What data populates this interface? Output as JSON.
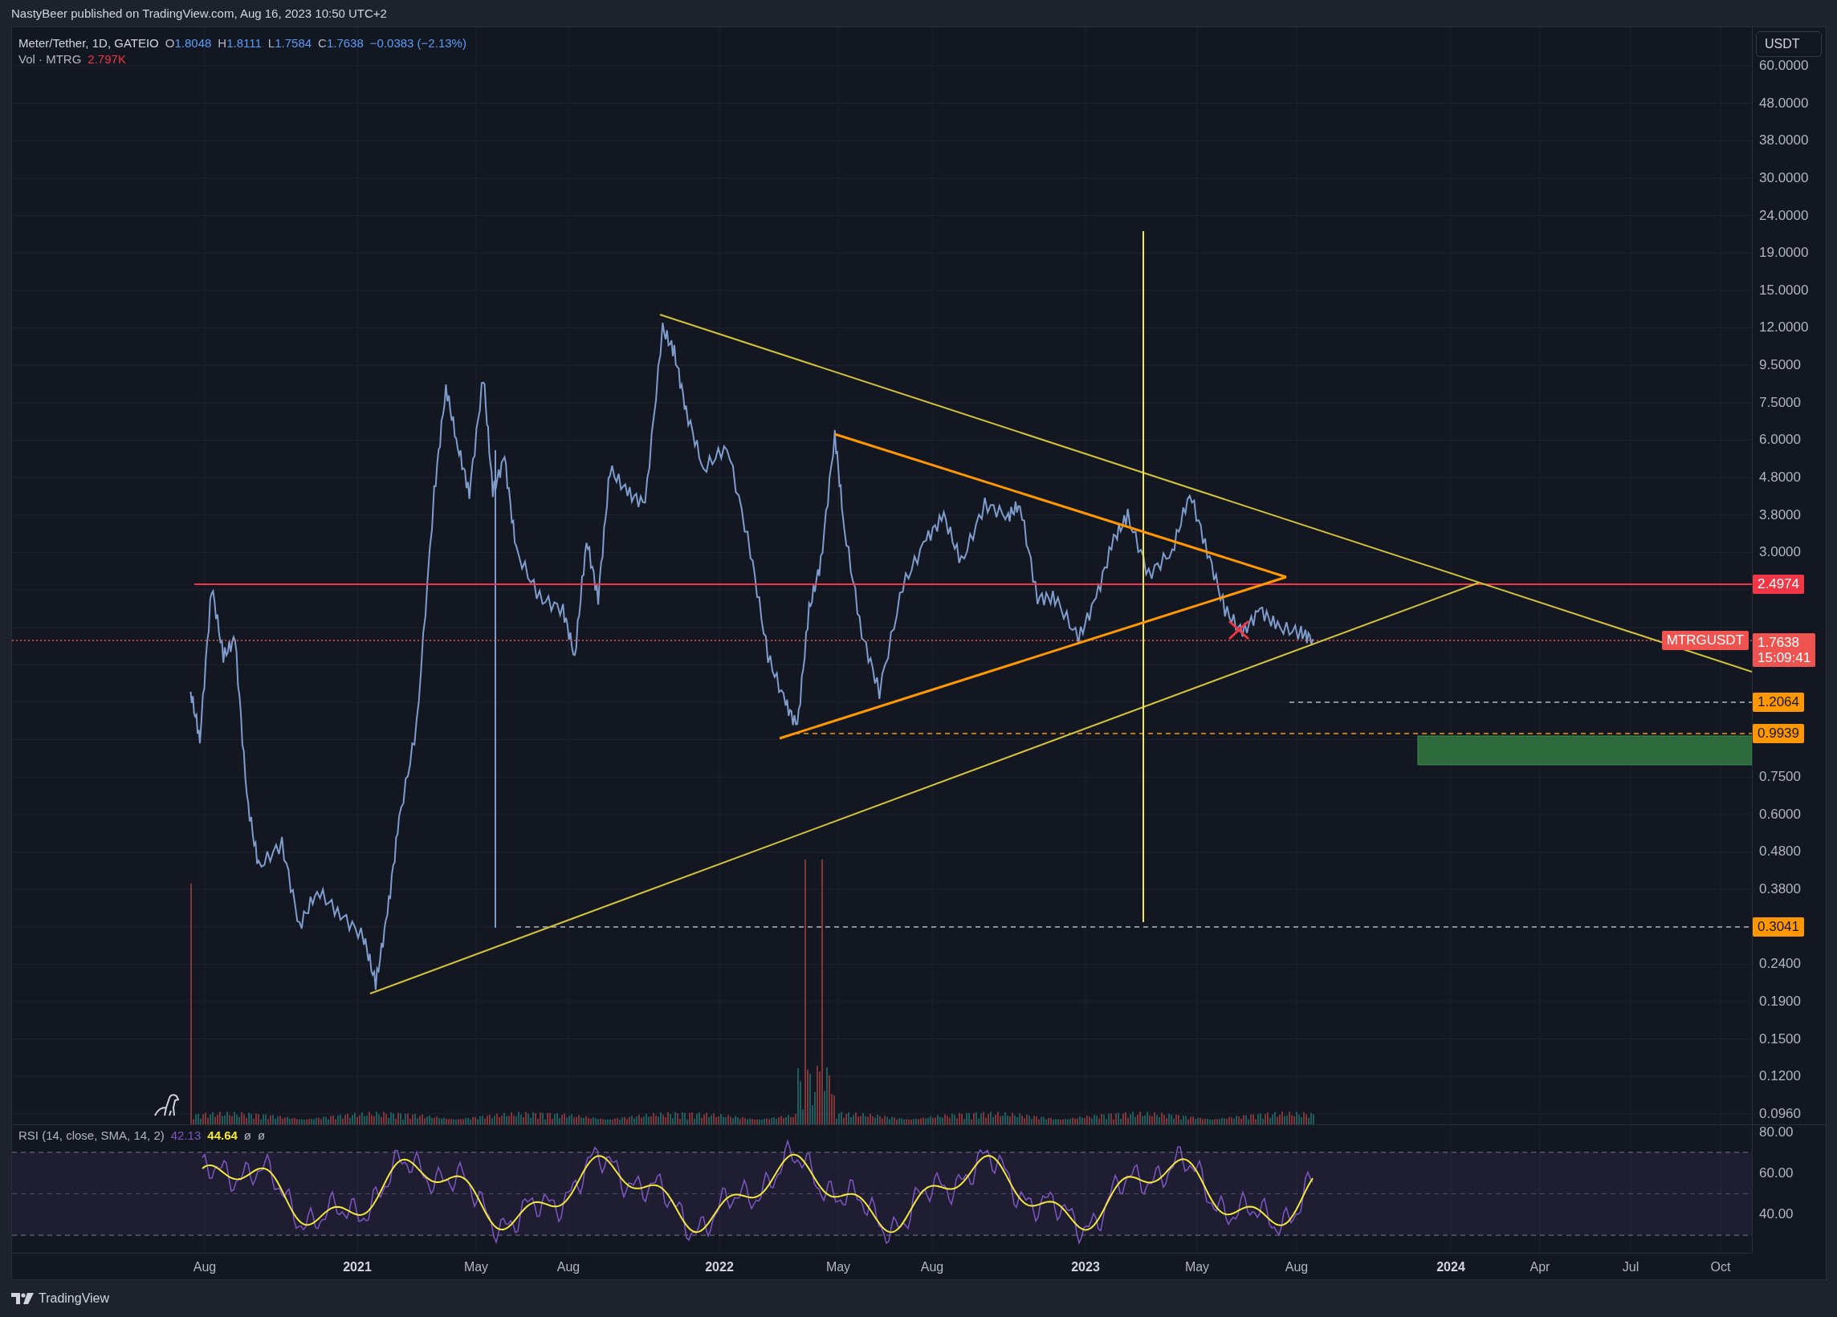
{
  "header": {
    "publisher_line": "NastyBeer published on TradingView.com, Aug 16, 2023 10:50 UTC+2"
  },
  "legend": {
    "symbol": "Meter/Tether, 1D, GATEIO",
    "ohlc": [
      {
        "label": "O",
        "value": "1.8048"
      },
      {
        "label": "H",
        "value": "1.8111"
      },
      {
        "label": "L",
        "value": "1.7584"
      },
      {
        "label": "C",
        "value": "1.7638"
      }
    ],
    "change": "−0.0383 (−2.13%)",
    "volume_label": "Vol · MTRG",
    "volume_value": "2.797K"
  },
  "price_axis": {
    "currency_button": "USDT",
    "ticks": [
      "60.0000",
      "48.0000",
      "38.0000",
      "30.0000",
      "24.0000",
      "19.0000",
      "15.0000",
      "12.0000",
      "9.5000",
      "7.5000",
      "6.0000",
      "4.8000",
      "3.8000",
      "3.0000",
      "0.7500",
      "0.6000",
      "0.4800",
      "0.3800",
      "0.2400",
      "0.1900",
      "0.1500",
      "0.1200",
      "0.0960"
    ],
    "tags": [
      {
        "kind": "level",
        "value": "2.4974",
        "color": "#f23645"
      },
      {
        "kind": "last",
        "symbol": "MTRGUSDT",
        "value": "1.7638",
        "countdown": "15:09:41",
        "color": "#ef5350"
      },
      {
        "kind": "level",
        "value": "1.2064",
        "color": "#ff9800"
      },
      {
        "kind": "level",
        "value": "0.9939",
        "color": "#ff9800"
      },
      {
        "kind": "level",
        "value": "0.3041",
        "color": "#ff9800"
      }
    ]
  },
  "rsi": {
    "legend": "RSI (14, close, SMA, 14, 2)",
    "value": "42.13",
    "sma_value": "44.64",
    "extras": [
      "ø",
      "ø"
    ],
    "ticks": [
      "80.00",
      "60.00",
      "40.00"
    ]
  },
  "time_axis": {
    "labels": [
      {
        "text": "Aug",
        "kind": "month"
      },
      {
        "text": "2021",
        "kind": "year"
      },
      {
        "text": "May",
        "kind": "month"
      },
      {
        "text": "Aug",
        "kind": "month"
      },
      {
        "text": "2022",
        "kind": "year"
      },
      {
        "text": "May",
        "kind": "month"
      },
      {
        "text": "Aug",
        "kind": "month"
      },
      {
        "text": "2023",
        "kind": "year"
      },
      {
        "text": "May",
        "kind": "month"
      },
      {
        "text": "Aug",
        "kind": "month"
      },
      {
        "text": "2024",
        "kind": "year"
      },
      {
        "text": "Apr",
        "kind": "month"
      },
      {
        "text": "Jul",
        "kind": "month"
      },
      {
        "text": "Oct",
        "kind": "month"
      }
    ]
  },
  "footer": {
    "brand": "TradingView"
  }
}
